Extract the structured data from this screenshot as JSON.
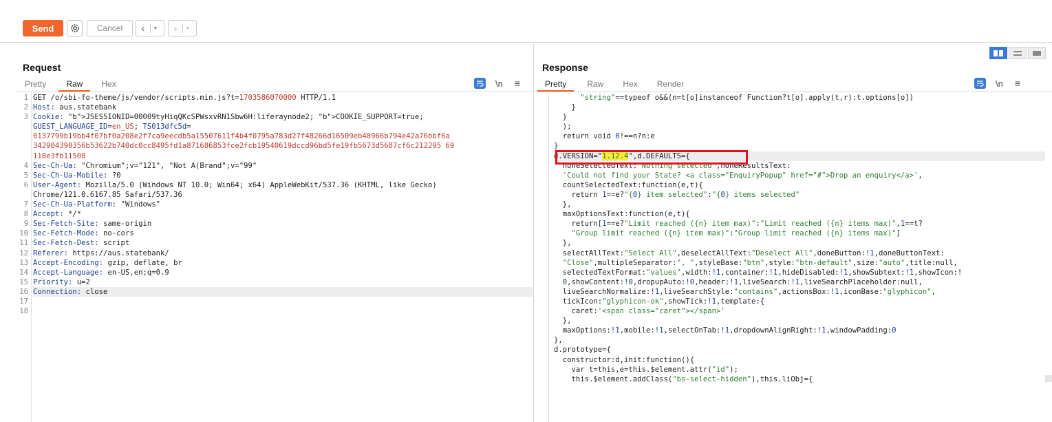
{
  "toolbar": {
    "send": "Send",
    "cancel": "Cancel"
  },
  "request": {
    "title": "Request",
    "tabs": [
      "Pretty",
      "Raw",
      "Hex"
    ],
    "active_tab": "Raw",
    "newline_toggle": "\\n",
    "lines": [
      {
        "n": "1",
        "text": "GET /o/sbi-fo-theme/js/vendor/scripts.min.js?t=1703586070000 HTTP/1.1"
      },
      {
        "n": "2",
        "key": "Host",
        "text": "aus.statebank"
      },
      {
        "n": "3",
        "key": "Cookie",
        "text": "JSESSIONID=00009tyHiqQKcSPWsxvRN1Sbw6H:liferaynode2; COOKIE_SUPPORT=true;"
      },
      {
        "n": "",
        "text": "GUEST_LANGUAGE_ID=en_US; TS013dfc5d="
      },
      {
        "n": "",
        "text": "0137799b19bb4f07bf0a208e2f7ca9eecdb5a15507611f4b4f0795a783d27f48266d16509eb48966b794e42a76bbf6a"
      },
      {
        "n": "",
        "text": "342904390356b53622b740dc0cc8495fd1a871686853fce2fcb19540619dccd96bd5fe19fb5673d5687cf6c212295 69"
      },
      {
        "n": "",
        "text": "118e3fb11508"
      },
      {
        "n": "4",
        "key": "Sec-Ch-Ua",
        "text": "\"Chromium\";v=\"121\", \"Not A(Brand\";v=\"99\""
      },
      {
        "n": "5",
        "key": "Sec-Ch-Ua-Mobile",
        "text": "?0"
      },
      {
        "n": "6",
        "key": "User-Agent",
        "text": "Mozilla/5.0 (Windows NT 10.0; Win64; x64) AppleWebKit/537.36 (KHTML, like Gecko)"
      },
      {
        "n": "",
        "text": "Chrome/121.0.6167.85 Safari/537.36"
      },
      {
        "n": "7",
        "key": "Sec-Ch-Ua-Platform",
        "text": "\"Windows\""
      },
      {
        "n": "8",
        "key": "Accept",
        "text": "*/*"
      },
      {
        "n": "9",
        "key": "Sec-Fetch-Site",
        "text": "same-origin"
      },
      {
        "n": "10",
        "key": "Sec-Fetch-Mode",
        "text": "no-cors"
      },
      {
        "n": "11",
        "key": "Sec-Fetch-Dest",
        "text": "script"
      },
      {
        "n": "12",
        "key": "Referer",
        "text": "https://aus.statebank/"
      },
      {
        "n": "13",
        "key": "Accept-Encoding",
        "text": "gzip, deflate, br"
      },
      {
        "n": "14",
        "key": "Accept-Language",
        "text": "en-US,en;q=0.9"
      },
      {
        "n": "15",
        "key": "Priority",
        "text": "u=2"
      },
      {
        "n": "16",
        "key": "Connection",
        "text": "close"
      },
      {
        "n": "17",
        "text": ""
      },
      {
        "n": "18",
        "text": ""
      }
    ]
  },
  "response": {
    "title": "Response",
    "tabs": [
      "Pretty",
      "Raw",
      "Hex",
      "Render"
    ],
    "active_tab": "Pretty",
    "newline_toggle": "\\n",
    "lines": [
      "      \"string\"==typeof o&&(n=t[o]instanceof Function?t[o].apply(t,r):t.options[o])",
      "    }",
      "  }",
      "  );",
      "  return void 0!==n?n:e",
      "}",
      "d.VERSION=\"1.12.4\",d.DEFAULTS={",
      "  noneSelectedText:\"Nothing selected\",noneResultsText:",
      "  'Could not find your State? <a class=\"EnquiryPopup\" href=\"#\">Drop an enquiry</a>',",
      "  countSelectedText:function(e,t){",
      "    return 1==e?\"{0} item selected\":\"{0} items selected\"",
      "  },",
      "  maxOptionsText:function(e,t){",
      "    return[1==e?\"Limit reached ({n} item max)\":\"Limit reached ({n} items max)\",1==t?",
      "    \"Group limit reached ({n} item max)\":\"Group limit reached ({n} items max)\"]",
      "  },",
      "  selectAllText:\"Select All\",deselectAllText:\"Deselect All\",doneButton:!1,doneButtonText:",
      "  \"Close\",multipleSeparator:\", \",styleBase:\"btn\",style:\"btn-default\",size:\"auto\",title:null,",
      "  selectedTextFormat:\"values\",width:!1,container:!1,hideDisabled:!1,showSubtext:!1,showIcon:!",
      "  0,showContent:!0,dropupAuto:!0,header:!1,liveSearch:!1,liveSearchPlaceholder:null,",
      "  liveSearchNormalize:!1,liveSearchStyle:\"contains\",actionsBox:!1,iconBase:\"glyphicon\",",
      "  tickIcon:\"glyphicon-ok\",showTick:!1,template:{",
      "    caret:'<span class=\"caret\"></span>'",
      "  },",
      "  maxOptions:!1,mobile:!1,selectOnTab:!1,dropdownAlignRight:!1,windowPadding:0",
      "},",
      "d.prototype={",
      "  constructor:d,init:function(){",
      "    var t=this,e=this.$element.attr(\"id\");",
      "    this.$element.addClass(\"bs-select-hidden\"),this.liObj={"
    ],
    "version_highlight": "1.12.4"
  }
}
